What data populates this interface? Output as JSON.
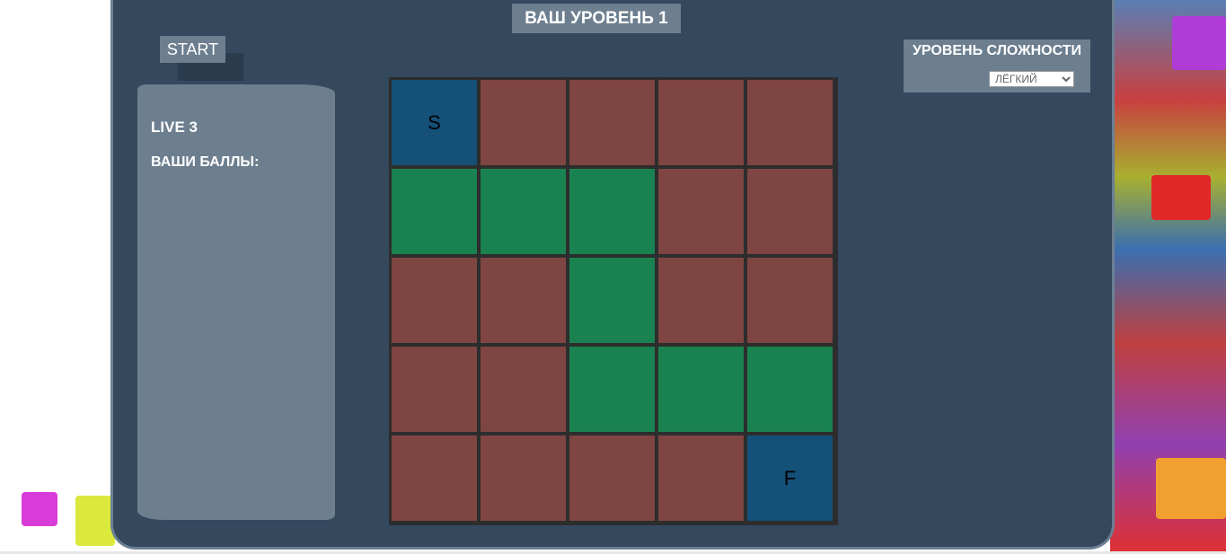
{
  "title": "ВАШ УРОВЕНЬ 1",
  "start_label": "START",
  "stats": {
    "live": "LIVE 3",
    "score_label": "ВАШИ БАЛЛЫ:"
  },
  "difficulty": {
    "label": "УРОВЕНЬ СЛОЖНОСТИ",
    "selected": "ЛЁГКИЙ"
  },
  "colors": {
    "wall": "#7e4542",
    "path": "#1a8250",
    "endpoint": "#145078"
  },
  "board": {
    "rows": [
      [
        {
          "type": "endpoint",
          "label": "S"
        },
        {
          "type": "wall",
          "label": ""
        },
        {
          "type": "wall",
          "label": ""
        },
        {
          "type": "wall",
          "label": ""
        },
        {
          "type": "wall",
          "label": ""
        }
      ],
      [
        {
          "type": "path",
          "label": ""
        },
        {
          "type": "path",
          "label": ""
        },
        {
          "type": "path",
          "label": ""
        },
        {
          "type": "wall",
          "label": ""
        },
        {
          "type": "wall",
          "label": ""
        }
      ],
      [
        {
          "type": "wall",
          "label": ""
        },
        {
          "type": "wall",
          "label": ""
        },
        {
          "type": "path",
          "label": ""
        },
        {
          "type": "wall",
          "label": ""
        },
        {
          "type": "wall",
          "label": ""
        }
      ],
      [
        {
          "type": "wall",
          "label": ""
        },
        {
          "type": "wall",
          "label": ""
        },
        {
          "type": "path",
          "label": ""
        },
        {
          "type": "path",
          "label": ""
        },
        {
          "type": "path",
          "label": ""
        }
      ],
      [
        {
          "type": "wall",
          "label": ""
        },
        {
          "type": "wall",
          "label": ""
        },
        {
          "type": "wall",
          "label": ""
        },
        {
          "type": "wall",
          "label": ""
        },
        {
          "type": "endpoint",
          "label": "F"
        }
      ]
    ]
  }
}
